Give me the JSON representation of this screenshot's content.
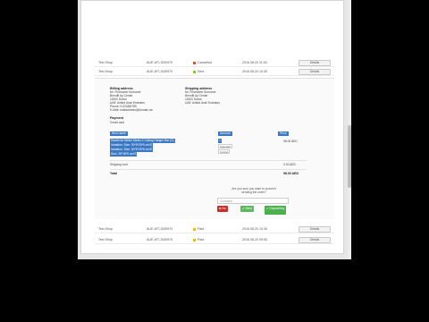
{
  "orders": [
    {
      "shop": "Test Shop",
      "id": "AUE-WT-1530970",
      "status": "Cancelled",
      "status_color": "#d9534f",
      "date": "2016.08.20 11:53",
      "action": "Details"
    },
    {
      "shop": "Test Shop",
      "id": "AUE-WT-1530970",
      "status": "Sent",
      "status_color": "#8cc63f",
      "date": "2016.08.20 10:35",
      "action": "Details"
    },
    {
      "shop": "Test Shop",
      "id": "AUE-WT-1530970",
      "status": "Paid",
      "status_color": "#f2b51c",
      "date": "2016.08.20 10:35",
      "action": "Details"
    },
    {
      "shop": "Test Shop",
      "id": "AUE-WT-1530970",
      "status": "Paid",
      "status_color": "#f2b51c",
      "date": "2016.08.20 09:53",
      "action": "Details"
    },
    {
      "shop": "Test Shop",
      "id": "AUE-WT-1530970",
      "status": "Sent",
      "status_color": "#8cc63f",
      "date": "2016.08.06 09:55",
      "action": "Details"
    }
  ],
  "detail": {
    "billing": {
      "title": "Billing address",
      "lines": [
        "Mr. Firstname Surname",
        "Benoffl Ay Center",
        "11500 Dubai",
        "UAE United Arab Emirates",
        "Phone: 0123456789",
        "E-Mail: mailaddress@domain.ae"
      ]
    },
    "shipping": {
      "title": "Shipping address",
      "lines": [
        "Mr. Firstname Surname",
        "Benoffl Ay Center",
        "11500 Dubai",
        "UAE United Arab Emirates"
      ]
    },
    "payment": {
      "title": "Payment",
      "value": "Credit card"
    },
    "table": {
      "headers": {
        "item": "Item name",
        "amount": "Amount",
        "price": "Price"
      },
      "item_lines": [
        "Health for Better Meals 2 Ceiling Hanger Bar (S)",
        "Variation: Size: 30*5*25*5 cm/S",
        "Variation: Size: 30*5*25*5 cm/S",
        "Size: 25*18*5 cm/S"
      ],
      "amount": "1",
      "select_1": "Standard",
      "select_2": "Cancel",
      "item_price": "98.00 AED",
      "shipping_label": "Shipping cost",
      "shipping_price": "0.00 AED",
      "total_label": "Total",
      "total_price": "98.00 AED"
    },
    "confirm_text": "Are you sure you want to proceed sending the order?",
    "comment_placeholder": "Comment",
    "buttons": {
      "cancel": "✖ No",
      "save": "✔ Send",
      "ship": "✔ Dispatching"
    }
  }
}
